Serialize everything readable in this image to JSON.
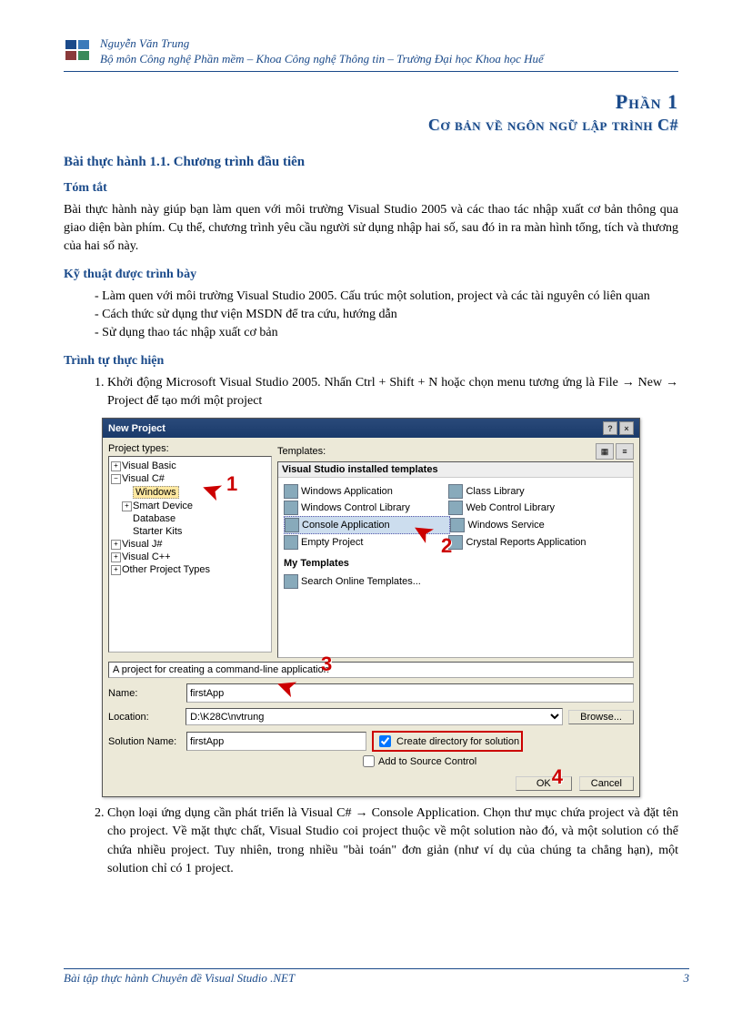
{
  "header": {
    "author": "Nguyễn Văn Trung",
    "dept": "Bộ môn Công nghệ Phần mềm – Khoa Công nghệ Thông tin – Trường Đại học Khoa học Huế"
  },
  "part": {
    "label": "Phần 1",
    "title": "Cơ bản về ngôn ngữ lập trình C#"
  },
  "lesson_title": "Bài thực hành 1.1. Chương trình đầu tiên",
  "sections": {
    "summary_h": "Tóm tắt",
    "summary_p": "Bài thực hành này giúp bạn làm quen với môi trường Visual Studio 2005 và các thao tác nhập xuất cơ bản thông qua giao diện bàn phím. Cụ thể, chương trình yêu cầu người sử dụng nhập hai số, sau đó in ra màn hình tổng, tích và thương của hai số này.",
    "tech_h": "Kỹ thuật được trình bày",
    "tech_items": [
      "Làm quen với môi trường Visual Studio 2005. Cấu trúc một solution, project và các tài nguyên có liên quan",
      "Cách thức sử dụng thư viện MSDN để tra cứu, hướng dẫn",
      "Sử dụng thao tác nhập xuất cơ bản"
    ],
    "steps_h": "Trình tự thực hiện",
    "step1": "Khởi động Microsoft Visual Studio 2005. Nhấn Ctrl + Shift + N hoặc chọn menu tương ứng là File → New → Project để tạo mới một project",
    "step2": "Chọn loại ứng dụng cần phát triển là Visual C# → Console Application. Chọn thư mục chứa project và đặt tên cho project. Về mặt thực chất, Visual Studio coi project thuộc về một solution nào đó, và một solution có thể chứa nhiều project. Tuy nhiên, trong nhiều \"bài toán\" đơn giản (như ví dụ của chúng ta chẳng hạn), một solution chỉ có 1 project."
  },
  "dialog": {
    "title": "New Project",
    "labels": {
      "project_types": "Project types:",
      "templates": "Templates:",
      "installed_head": "Visual Studio installed templates",
      "my_templates": "My Templates",
      "description": "A project for creating a command-line application",
      "name": "Name:",
      "location": "Location:",
      "solution_name": "Solution Name:",
      "browse": "Browse...",
      "create_dir": "Create directory for solution",
      "add_source": "Add to Source Control",
      "ok": "OK",
      "cancel": "Cancel"
    },
    "tree": {
      "vb": "Visual Basic",
      "cs": "Visual C#",
      "windows": "Windows",
      "smart": "Smart Device",
      "database": "Database",
      "starter": "Starter Kits",
      "vj": "Visual J#",
      "vcpp": "Visual C++",
      "other": "Other Project Types"
    },
    "templates": {
      "win_app": "Windows Application",
      "class_lib": "Class Library",
      "win_ctrl": "Windows Control Library",
      "web_ctrl": "Web Control Library",
      "console": "Console Application",
      "win_svc": "Windows Service",
      "empty": "Empty Project",
      "crystal": "Crystal Reports Application",
      "search": "Search Online Templates..."
    },
    "values": {
      "name": "firstApp",
      "location": "D:\\K28C\\nvtrung",
      "solution": "firstApp"
    },
    "callouts": {
      "c1": "1",
      "c2": "2",
      "c3": "3",
      "c4": "4"
    }
  },
  "footer": {
    "text": "Bài tập thực hành Chuyên đề Visual Studio .NET",
    "page": "3"
  }
}
